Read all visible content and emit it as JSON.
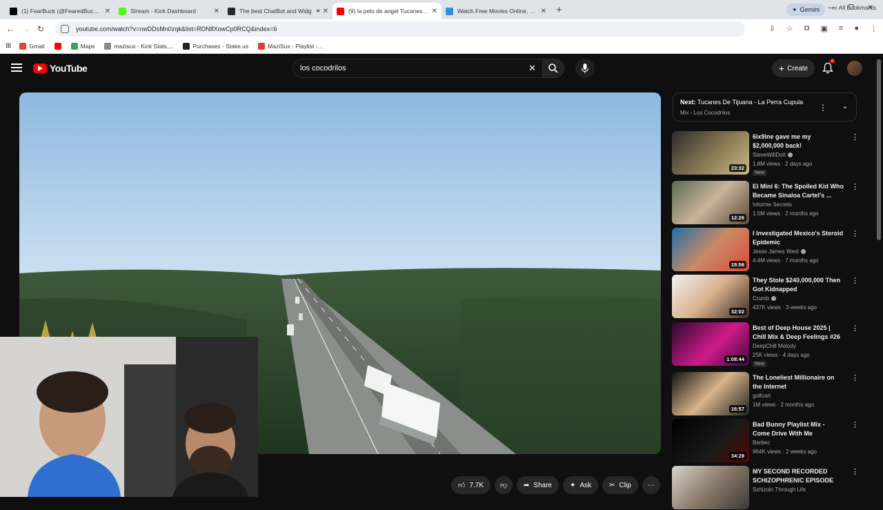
{
  "browser": {
    "tabs": [
      {
        "title": "(1) FearBuck (@FearedBuck) / X",
        "icon": "x-logo-icon",
        "color": "#000000",
        "active": false
      },
      {
        "title": "Stream - Kick Dashboard",
        "icon": "kick-logo-icon",
        "color": "#53fc18",
        "active": false
      },
      {
        "title": "The best ChatBot and Widg",
        "icon": "github-icon",
        "color": "#24292e",
        "active": false
      },
      {
        "title": "(9) la pelo de angel Tucanes de",
        "icon": "youtube-icon",
        "color": "#ff0000",
        "active": true
      },
      {
        "title": "Watch Free Movies Online, Stre",
        "icon": "globe-icon",
        "color": "#3a8dde",
        "active": false
      }
    ],
    "gemini_label": "Gemini",
    "url": "youtube.com/watch?v=nwDDsMn0zqk&list=RDN8XowCp0RCQ&index=6",
    "bookmarks": [
      {
        "label": "Gmail",
        "color": "#ea4335"
      },
      {
        "label": "",
        "color": "#ff0000"
      },
      {
        "label": "Maps",
        "color": "#34a853"
      },
      {
        "label": "mazisux - Kick Stats,...",
        "color": "#888888"
      },
      {
        "label": "Purchases - Stake.us",
        "color": "#222222"
      },
      {
        "label": "MaziSux - Playlist -...",
        "color": "#e53935"
      }
    ],
    "all_bookmarks_label": "All Bookmarks"
  },
  "youtube": {
    "logo_text": "YouTube",
    "search_value": "los cocodrilos",
    "create_label": "Create",
    "notification_count": "6"
  },
  "player": {
    "like_count": "7.7K",
    "share_label": "Share",
    "ask_label": "Ask",
    "clip_label": "Clip"
  },
  "sidebar": {
    "next_prefix": "Next:",
    "next_title": "Tucanes De Tijuana - La Perra Cupula",
    "next_sub": "Mix - Los Cocodrilos",
    "items": [
      {
        "title": "6ix9ine gave me my $2,000,000 back!",
        "channel": "SteveWillDoIt",
        "meta": "1.8M views · 2 days ago",
        "duration": "23:32",
        "new": "New",
        "thumb": "linear-gradient(135deg,#2c2c2c,#8a7a55 55%,#c8b98a)"
      },
      {
        "title": "El Mini 6: The Spoiled Kid Who Became Sinaloa Cartel's ...",
        "channel": "Informe Secreto",
        "meta": "1.5M views · 2 months ago",
        "duration": "12:26",
        "new": "",
        "thumb": "linear-gradient(135deg,#5b6b52,#c9b39a 50%,#5a4a3a)"
      },
      {
        "title": "I Investigated Mexico's Steroid Epidemic",
        "channel": "Jesse James West",
        "meta": "4.4M views · 7 months ago",
        "duration": "15:56",
        "new": "",
        "thumb": "linear-gradient(135deg,#1f6fa8,#c98a66 50%,#d94a3a)"
      },
      {
        "title": "They Stole $240,000,000 Then Got Kidnapped",
        "channel": "Crumb",
        "meta": "437K views · 3 weeks ago",
        "duration": "32:02",
        "new": "",
        "thumb": "linear-gradient(135deg,#f2f2f2,#d9b08c 50%,#3b2a22)"
      },
      {
        "title": "Best of Deep House 2025 | Chill Mix & Deep Feelings #26",
        "channel": "DeepChill Melody",
        "meta": "25K views · 4 days ago",
        "duration": "1:08:44",
        "new": "New",
        "thumb": "linear-gradient(135deg,#2a0a2a,#d01a8a 55%,#3a0a3a)"
      },
      {
        "title": "The Loneliest Millionaire on the Internet",
        "channel": "golfcart",
        "meta": "1M views · 2 months ago",
        "duration": "16:57",
        "new": "",
        "thumb": "linear-gradient(135deg,#111111,#d9b48a 50%,#222222)"
      },
      {
        "title": "Bad Bunny Playlist Mix - Come Drive With Me",
        "channel": "Berbec",
        "meta": "964K views · 2 weeks ago",
        "duration": "34:28",
        "new": "",
        "thumb": "linear-gradient(135deg,#000000,#1a1a1a 60%,#5a0000)"
      },
      {
        "title": "MY SECOND RECORDED SCHIZOPHRENIC EPISODE",
        "channel": "Schizoin Through Life",
        "meta": "",
        "duration": "",
        "new": "",
        "thumb": "linear-gradient(135deg,#d8d4cc,#8a7a6a 50%,#3a3a3a)"
      }
    ]
  }
}
